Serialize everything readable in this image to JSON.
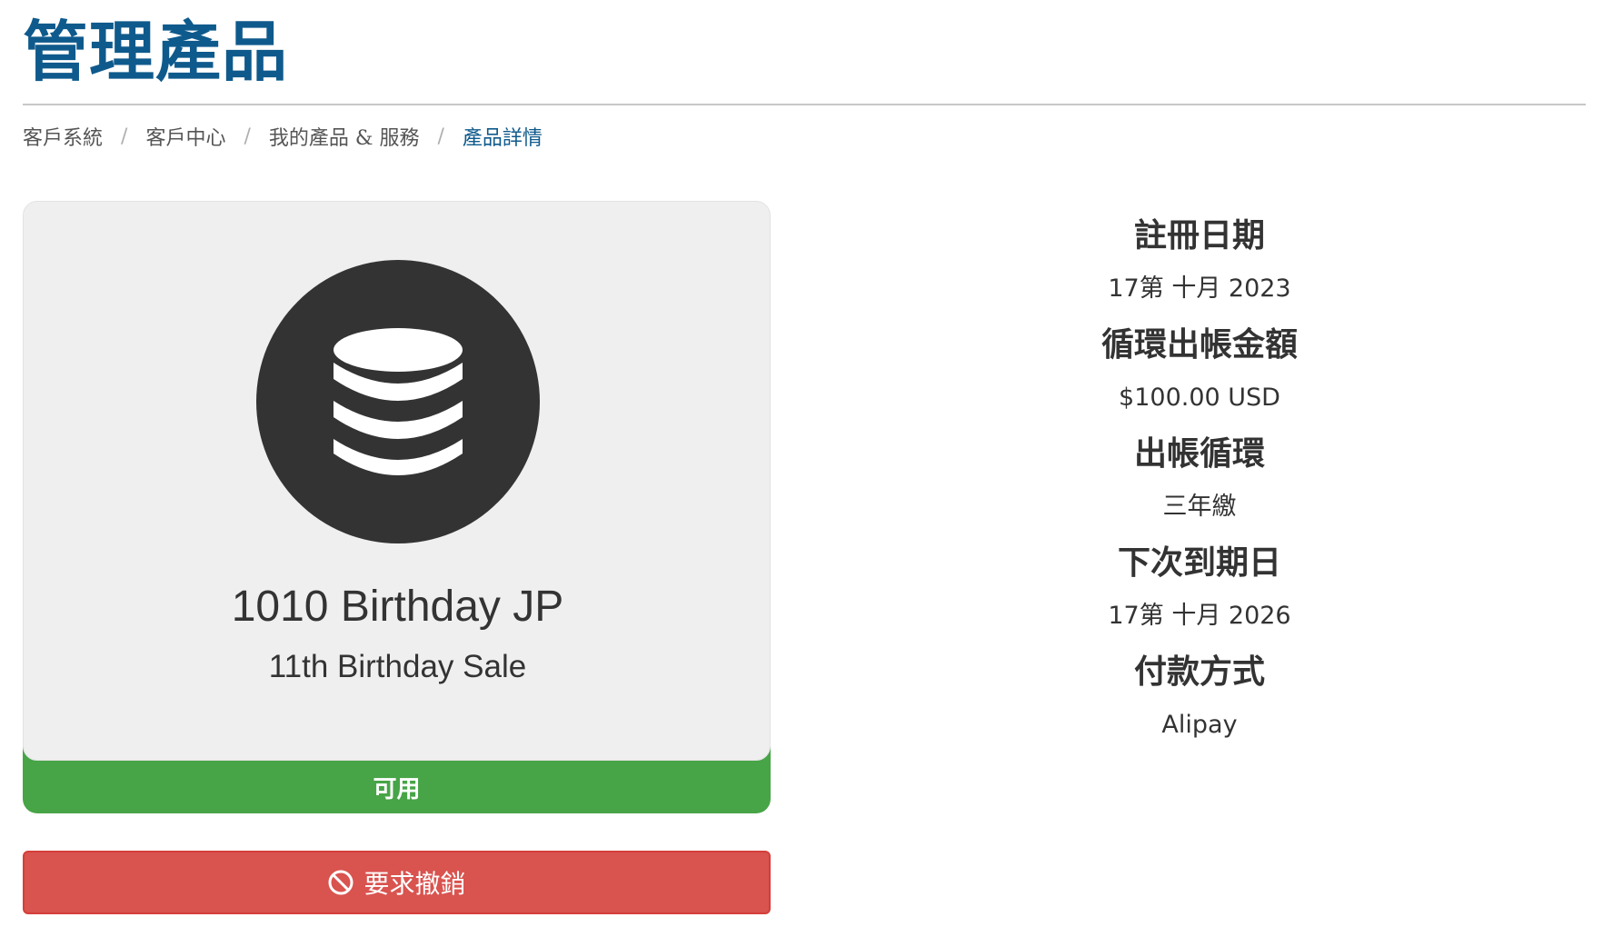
{
  "page": {
    "title": "管理產品"
  },
  "breadcrumb": {
    "items": [
      {
        "label": "客戶系統"
      },
      {
        "label": "客戶中心"
      },
      {
        "label": "我的產品 & 服務"
      },
      {
        "label": "產品詳情"
      }
    ],
    "separator": "/"
  },
  "product": {
    "icon": "database-icon",
    "name": "1010 Birthday JP",
    "group": "11th Birthday Sale",
    "status": "可用",
    "status_color": "#47a447"
  },
  "actions": {
    "cancel_label": "要求撤銷",
    "cancel_icon": "ban-icon",
    "cancel_color": "#d9534f"
  },
  "details": [
    {
      "label": "註冊日期",
      "value": "17第 十月 2023"
    },
    {
      "label": "循環出帳金額",
      "value": "$100.00 USD"
    },
    {
      "label": "出帳循環",
      "value": "三年繳"
    },
    {
      "label": "下次到期日",
      "value": "17第 十月 2026"
    },
    {
      "label": "付款方式",
      "value": "Alipay"
    }
  ],
  "colors": {
    "title": "#0f5a8c",
    "breadcrumb_active": "#0f5a8c"
  }
}
